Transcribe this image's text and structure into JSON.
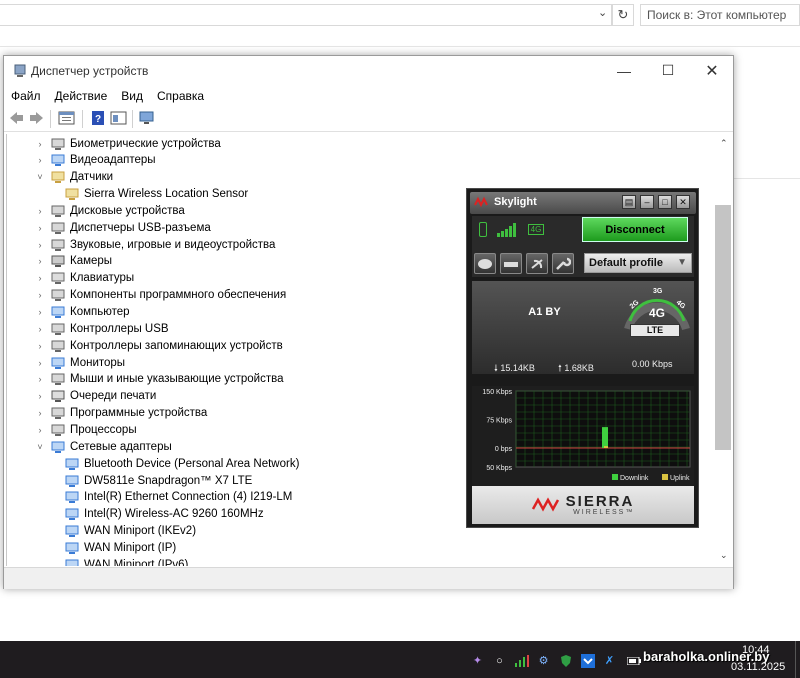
{
  "explorer": {
    "search_placeholder": "Поиск в: Этот компьютер"
  },
  "device_manager": {
    "title": "Диспетчер устройств",
    "menu": [
      "Файл",
      "Действие",
      "Вид",
      "Справка"
    ],
    "tree": [
      {
        "label": "Биометрические устройства",
        "level": 0,
        "expanded": false,
        "icon": "biometric-icon"
      },
      {
        "label": "Видеоадаптеры",
        "level": 0,
        "expanded": false,
        "icon": "display-adapter-icon"
      },
      {
        "label": "Датчики",
        "level": 0,
        "expanded": true,
        "icon": "sensor-icon"
      },
      {
        "label": "Sierra Wireless Location Sensor",
        "level": 1,
        "icon": "sensor-icon"
      },
      {
        "label": "Дисковые устройства",
        "level": 0,
        "expanded": false,
        "icon": "disk-drive-icon"
      },
      {
        "label": "Диспетчеры USB-разъема",
        "level": 0,
        "expanded": false,
        "icon": "usb-connector-icon"
      },
      {
        "label": "Звуковые, игровые и видеоустройства",
        "level": 0,
        "expanded": false,
        "icon": "sound-icon"
      },
      {
        "label": "Камеры",
        "level": 0,
        "expanded": false,
        "icon": "camera-icon"
      },
      {
        "label": "Клавиатуры",
        "level": 0,
        "expanded": false,
        "icon": "keyboard-icon"
      },
      {
        "label": "Компоненты программного обеспечения",
        "level": 0,
        "expanded": false,
        "icon": "software-component-icon"
      },
      {
        "label": "Компьютер",
        "level": 0,
        "expanded": false,
        "icon": "computer-icon"
      },
      {
        "label": "Контроллеры USB",
        "level": 0,
        "expanded": false,
        "icon": "usb-icon"
      },
      {
        "label": "Контроллеры запоминающих устройств",
        "level": 0,
        "expanded": false,
        "icon": "storage-controller-icon"
      },
      {
        "label": "Мониторы",
        "level": 0,
        "expanded": false,
        "icon": "monitor-icon"
      },
      {
        "label": "Мыши и иные указывающие устройства",
        "level": 0,
        "expanded": false,
        "icon": "mouse-icon"
      },
      {
        "label": "Очереди печати",
        "level": 0,
        "expanded": false,
        "icon": "printer-icon"
      },
      {
        "label": "Программные устройства",
        "level": 0,
        "expanded": false,
        "icon": "software-device-icon"
      },
      {
        "label": "Процессоры",
        "level": 0,
        "expanded": false,
        "icon": "processor-icon"
      },
      {
        "label": "Сетевые адаптеры",
        "level": 0,
        "expanded": true,
        "icon": "network-adapter-icon"
      },
      {
        "label": "Bluetooth Device (Personal Area Network)",
        "level": 1,
        "icon": "network-adapter-icon"
      },
      {
        "label": "DW5811e Snapdragon™ X7 LTE",
        "level": 1,
        "icon": "network-adapter-icon"
      },
      {
        "label": "Intel(R) Ethernet Connection (4) I219-LM",
        "level": 1,
        "icon": "network-adapter-icon"
      },
      {
        "label": "Intel(R) Wireless-AC 9260 160MHz",
        "level": 1,
        "icon": "network-adapter-icon"
      },
      {
        "label": "WAN Miniport (IKEv2)",
        "level": 1,
        "icon": "network-adapter-icon"
      },
      {
        "label": "WAN Miniport (IP)",
        "level": 1,
        "icon": "network-adapter-icon"
      },
      {
        "label": "WAN Miniport (IPv6)",
        "level": 1,
        "icon": "network-adapter-icon"
      }
    ]
  },
  "skylight": {
    "title": "Skylight",
    "tech_badge": "4G",
    "disconnect_label": "Disconnect",
    "profile": "Default profile",
    "operator": "A1 BY",
    "downloaded": "15.14KB",
    "uploaded": "1.68KB",
    "rate": "0.00 Kbps",
    "gauge_labels": [
      "2G",
      "3G",
      "4G",
      "4G"
    ],
    "network_type": "LTE",
    "brand": "SIERRA",
    "brand_sub": "WIRELESS™",
    "colors": {
      "connected": "#2fbf2f",
      "downlink": "#3fd03f",
      "uplink": "#d9c240"
    }
  },
  "chart_data": {
    "type": "bar",
    "title": "",
    "ylabel": "",
    "yticks": [
      "150 Kbps",
      "75 Kbps",
      "0 bps",
      "50 Kbps"
    ],
    "ylim": [
      -50,
      150
    ],
    "series": [
      {
        "name": "Downlink",
        "values": [
          55
        ]
      },
      {
        "name": "Uplink",
        "values": [
          5
        ]
      }
    ]
  },
  "taskbar": {
    "time": "10:44",
    "date": "03.11.2025",
    "watermark": "baraholka.onliner.by"
  }
}
